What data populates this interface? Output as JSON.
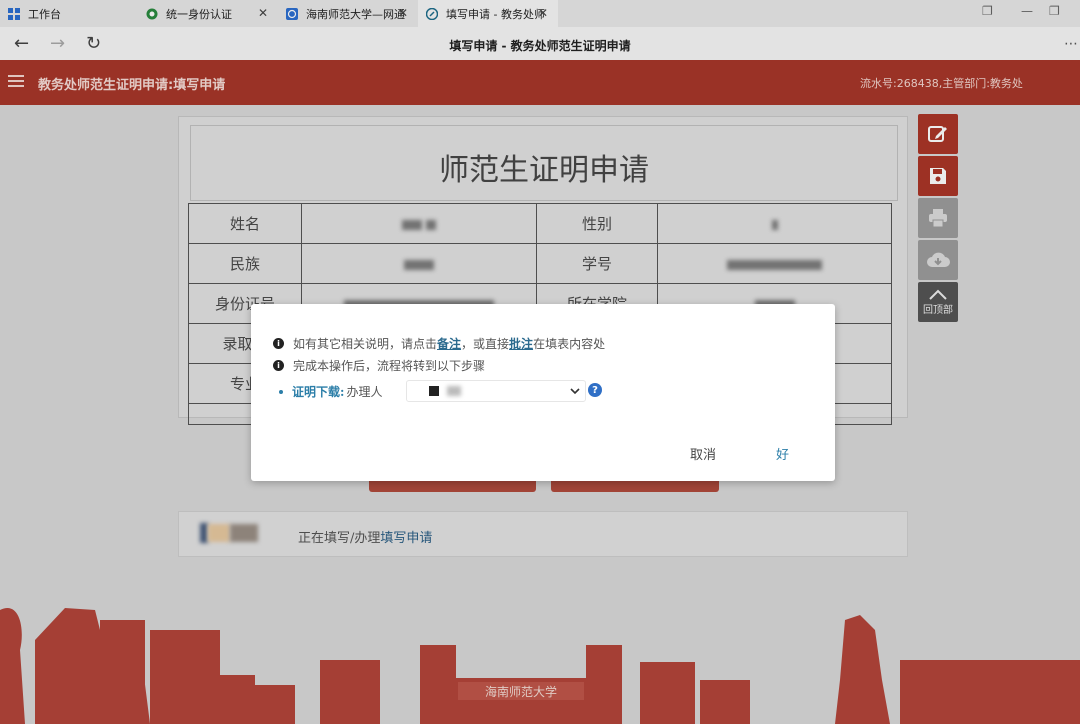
{
  "tabs": [
    {
      "label": "工作台"
    },
    {
      "label": "统一身份认证"
    },
    {
      "label": "海南师范大学—网通"
    },
    {
      "label": "填写申请 - 教务处师"
    }
  ],
  "page": {
    "title": "填写申请 - 教务处师范生证明申请"
  },
  "app": {
    "title": "教务处师范生证明申请:填写申请",
    "serial": "流水号:268438,主管部门:教务处"
  },
  "form": {
    "title": "师范生证明申请",
    "rows": [
      {
        "label1": "姓名",
        "label2": "性别"
      },
      {
        "label1": "民族",
        "label2": "学号"
      },
      {
        "label1": "身份证号",
        "label2": "所在学院"
      },
      {
        "label1": "录取年"
      },
      {
        "label1": "专业"
      }
    ]
  },
  "side": {
    "back_top_label": "回顶部"
  },
  "status": {
    "prefix": "正在填写/办理",
    "action": "填写申请"
  },
  "dialog": {
    "line1_prefix": "如有其它相关说明，请点击",
    "line1_link1": "备注",
    "line1_mid": "，或直接",
    "line1_link2": "批注",
    "line1_suffix": "在填表内容处",
    "line2": "完成本操作后，流程将转到以下步骤",
    "cert_label": "证明下载:",
    "handler_label": "办理人",
    "help": "?",
    "cancel": "取消",
    "ok": "好"
  },
  "banner": {
    "text": "海南师范大学"
  },
  "colors": {
    "brand_red": "#a8372a",
    "link_blue": "#2b7ea8"
  }
}
